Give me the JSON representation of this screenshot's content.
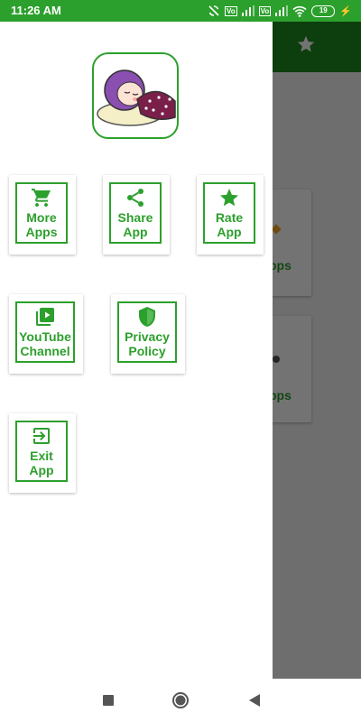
{
  "status_bar": {
    "time": "11:26 AM",
    "vo_label": "Vo",
    "battery": "19"
  },
  "background": {
    "card1_text": "pps",
    "card2_text": "pps"
  },
  "drawer": {
    "tiles": [
      {
        "line1": "More",
        "line2": "Apps",
        "icon": "cart-icon"
      },
      {
        "line1": "Share",
        "line2": "App",
        "icon": "share-icon"
      },
      {
        "line1": "Rate",
        "line2": "App",
        "icon": "star-icon"
      },
      {
        "line1": "YouTube",
        "line2": "Channel",
        "icon": "youtube-icon"
      },
      {
        "line1": "Privacy",
        "line2": "Policy",
        "icon": "shield-icon"
      },
      {
        "line1": "Exit",
        "line2": "App",
        "icon": "exit-icon"
      }
    ]
  },
  "colors": {
    "accent": "#2ca02c",
    "statusbar": "#2ca02c",
    "appbar": "#1e8a1e"
  }
}
